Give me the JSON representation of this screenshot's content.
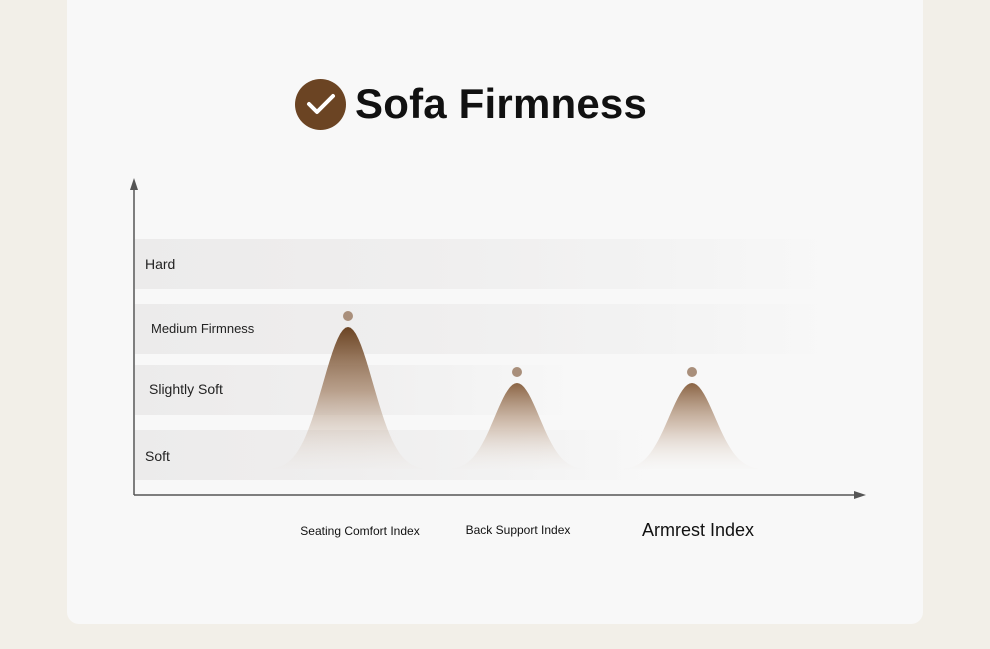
{
  "chart_data": {
    "type": "area",
    "title": "Sofa Firmness",
    "xlabel": "",
    "ylabel": "",
    "y_levels": [
      "Soft",
      "Slightly Soft",
      "Medium Firmness",
      "Hard"
    ],
    "categories": [
      "Seating Comfort Index",
      "Back Support Index",
      "Armrest Index"
    ],
    "series": [
      {
        "values": [
          "Medium Firmness",
          "Slightly Soft",
          "Slightly Soft"
        ]
      }
    ],
    "grid": true,
    "legend": "none"
  },
  "colors": {
    "accent": "#6b4423",
    "marker": "#a98f7b",
    "axis": "#555555"
  },
  "icons": {
    "title_icon": "check-circle-icon"
  }
}
